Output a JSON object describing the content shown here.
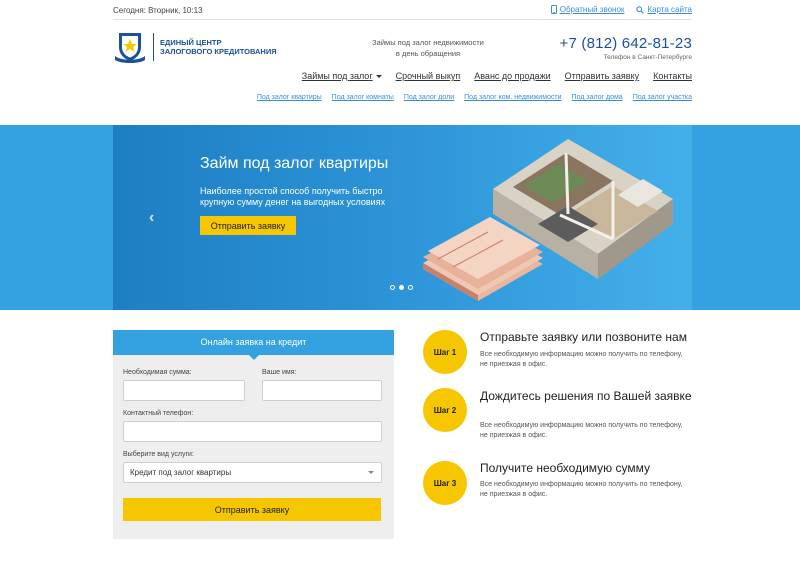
{
  "topbar": {
    "today": "Сегодня: Вторник, 10:13",
    "callback_label": "Обратный звонок",
    "sitemap_label": "Карта сайта"
  },
  "header": {
    "logo_line1": "Единый центр",
    "logo_line2": "залогового кредитования",
    "tagline_line1": "Займы под залог недвижимости",
    "tagline_line2": "в день обращения",
    "phone": "+7 (812) 642-81-23",
    "phone_note": "Телефон в Санкт-Петербурге"
  },
  "mainnav": {
    "items": [
      "Займы под залог",
      "Срочный выкуп",
      "Аванс до продажи",
      "Отправить заявку",
      "Контакты"
    ]
  },
  "subnav": {
    "items": [
      "Под залог квартиры",
      "Под залог комнаты",
      "Под залог доли",
      "Под залог ком. недвижимости",
      "Под залог дома",
      "Под залог участка"
    ]
  },
  "hero": {
    "title": "Займ под залог квартиры",
    "subtitle": "Наиболее простой способ получить быстро крупную сумму денег на выгодных условиях",
    "button": "Отправить заявку",
    "prev_arrow": "‹"
  },
  "form": {
    "title": "Онлайн заявка на кредит",
    "amount_label": "Необходимая сумма:",
    "name_label": "Ваше имя:",
    "phone_label": "Контактный телефон:",
    "service_label": "Выберите вид услуги:",
    "service_value": "Кредит под залог квартиры",
    "submit": "Отправить заявку"
  },
  "steps": [
    {
      "badge": "Шаг 1",
      "title": "Отправьте заявку или позвоните нам",
      "text": "Все необходимую информацию можно получить по телефону, не приезжая в офис."
    },
    {
      "badge": "Шаг 2",
      "title": "Дождитесь решения по Вашей заявке",
      "text": "Все необходимую информацию можно получить по телефону, не приезжая в офис."
    },
    {
      "badge": "Шаг 3",
      "title": "Получите необходимую сумму",
      "text": "Все необходимую информацию можно получить по телефону, не приезжая в офис."
    }
  ],
  "colors": {
    "accent_blue": "#34a2e0",
    "brand_navy": "#1c4f9c",
    "button_yellow": "#f6c700"
  },
  "icons": {
    "callback": "phone-icon",
    "sitemap": "search-icon",
    "slider_prev": "chevron-left-icon"
  }
}
